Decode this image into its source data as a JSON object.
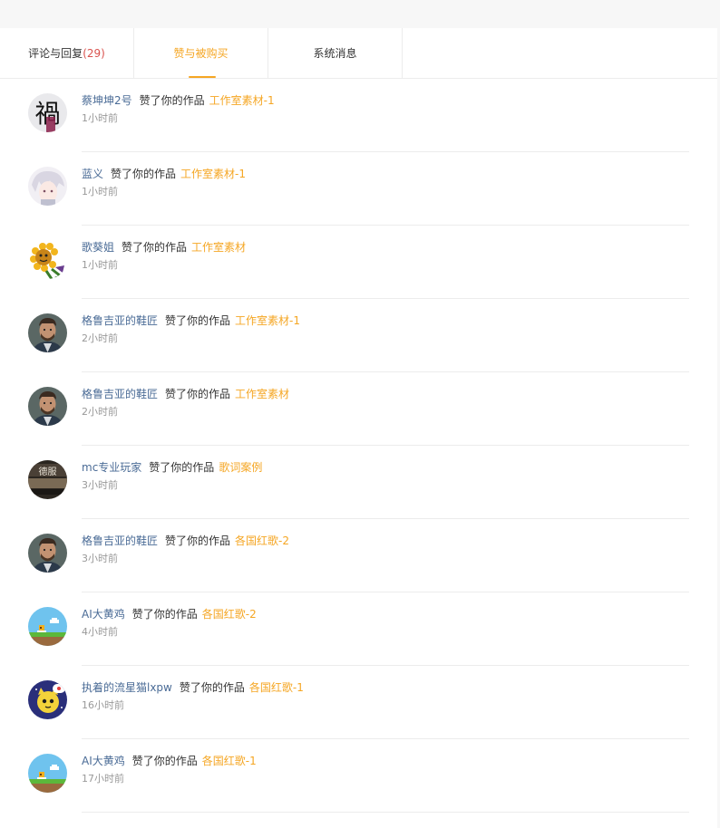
{
  "tabs": [
    {
      "label": "评论与回复",
      "count": "(29)"
    },
    {
      "label": "赞与被购买"
    },
    {
      "label": "系统消息"
    }
  ],
  "colors": {
    "accent": "#f5a623",
    "user": "#4a6b96",
    "count": "#d9534f"
  },
  "notifications": [
    {
      "user": "蔡坤坤2号",
      "action": "赞了你的作品",
      "work": "工作室素材-1",
      "time": "1小时前",
      "avatar_icon": "calligraphy-avatar-icon"
    },
    {
      "user": "蓝义",
      "action": "赞了你的作品",
      "work": "工作室素材-1",
      "time": "1小时前",
      "avatar_icon": "anime-avatar-icon"
    },
    {
      "user": "歌葵姐",
      "action": "赞了你的作品",
      "work": "工作室素材",
      "time": "1小时前",
      "avatar_icon": "sunflower-avatar-icon"
    },
    {
      "user": "格鲁吉亚的鞋匠",
      "action": "赞了你的作品",
      "work": "工作室素材-1",
      "time": "2小时前",
      "avatar_icon": "man-portrait-avatar-icon"
    },
    {
      "user": "格鲁吉亚的鞋匠",
      "action": "赞了你的作品",
      "work": "工作室素材",
      "time": "2小时前",
      "avatar_icon": "man-portrait-avatar-icon"
    },
    {
      "user": "mc专业玩家",
      "action": "赞了你的作品",
      "work": "歌词案例",
      "time": "3小时前",
      "avatar_icon": "dark-photo-avatar-icon"
    },
    {
      "user": "格鲁吉亚的鞋匠",
      "action": "赞了你的作品",
      "work": "各国红歌-2",
      "time": "3小时前",
      "avatar_icon": "man-portrait-avatar-icon"
    },
    {
      "user": "AI大黄鸡",
      "action": "赞了你的作品",
      "work": "各国红歌-2",
      "time": "4小时前",
      "avatar_icon": "pixel-landscape-avatar-icon"
    },
    {
      "user": "执着的流星猫lxpw",
      "action": "赞了你的作品",
      "work": "各国红歌-1",
      "time": "16小时前",
      "avatar_icon": "cartoon-cat-avatar-icon"
    },
    {
      "user": "AI大黄鸡",
      "action": "赞了你的作品",
      "work": "各国红歌-1",
      "time": "17小时前",
      "avatar_icon": "pixel-landscape-avatar-icon"
    }
  ],
  "avatar_glyphs": {
    "calligraphy-avatar-icon": "禍",
    "dark-photo-avatar-icon": "德服"
  }
}
